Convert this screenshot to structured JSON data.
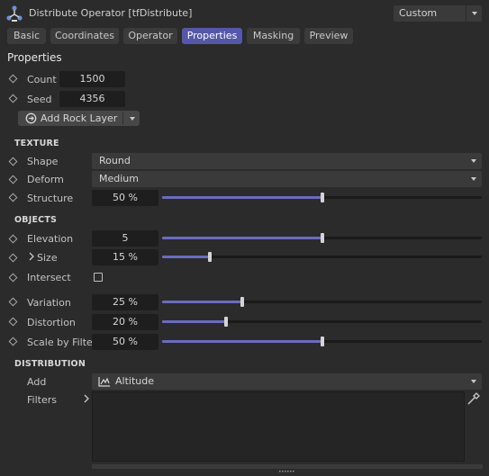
{
  "window": {
    "title": "Distribute Operator [tfDistribute]",
    "preset": "Custom"
  },
  "tabs": [
    {
      "label": "Basic",
      "active": false
    },
    {
      "label": "Coordinates",
      "active": false
    },
    {
      "label": "Operator",
      "active": false
    },
    {
      "label": "Properties",
      "active": true
    },
    {
      "label": "Masking",
      "active": false
    },
    {
      "label": "Preview",
      "active": false
    }
  ],
  "properties": {
    "title": "Properties",
    "count": {
      "label": "Count",
      "value": "1500"
    },
    "seed": {
      "label": "Seed",
      "value": "4356"
    },
    "add_rock_layer": "Add Rock Layer"
  },
  "texture": {
    "header": "TEXTURE",
    "shape": {
      "label": "Shape",
      "value": "Round"
    },
    "deform": {
      "label": "Deform",
      "value": "Medium"
    },
    "structure": {
      "label": "Structure",
      "value": "50 %",
      "level": 0.5
    }
  },
  "objects": {
    "header": "OBJECTS",
    "elevation": {
      "label": "Elevation",
      "value": "5",
      "level": 0.5
    },
    "size": {
      "label": "Size",
      "value": "15 %",
      "level": 0.15
    },
    "intersect": {
      "label": "Intersect",
      "checked": false
    },
    "variation": {
      "label": "Variation",
      "value": "25 %",
      "level": 0.25
    },
    "distortion": {
      "label": "Distortion",
      "value": "20 %",
      "level": 0.2
    },
    "scale_by_filter": {
      "label": "Scale by Filter",
      "value": "50 %",
      "level": 0.5
    }
  },
  "distribution": {
    "header": "DISTRIBUTION",
    "add": {
      "label": "Add",
      "value": "Altitude"
    },
    "filters": {
      "label": "Filters"
    }
  },
  "colors": {
    "accent": "#5557a8",
    "slider_fill": "#6a6cc0",
    "background": "#2b2b2b"
  },
  "icons": {
    "app": "distribute-operator-icon",
    "add_rock": "add-circle-icon",
    "altitude": "altitude-chart-icon",
    "picker": "eyedropper-icon"
  }
}
